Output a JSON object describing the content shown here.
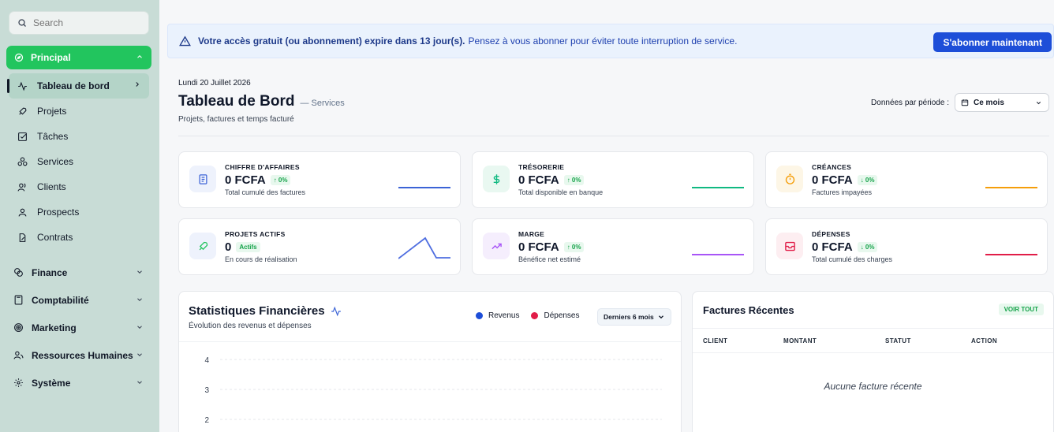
{
  "sidebar": {
    "search_placeholder": "Search",
    "principal_label": "Principal",
    "items": [
      {
        "label": "Tableau de bord",
        "icon": "activity-icon"
      },
      {
        "label": "Projets",
        "icon": "rocket-icon"
      },
      {
        "label": "Tâches",
        "icon": "checkbox-icon"
      },
      {
        "label": "Services",
        "icon": "boxes-icon"
      },
      {
        "label": "Clients",
        "icon": "users-icon"
      },
      {
        "label": "Prospects",
        "icon": "user-icon"
      },
      {
        "label": "Contrats",
        "icon": "file-edit-icon"
      }
    ],
    "groups": [
      {
        "label": "Finance",
        "icon": "coins-icon"
      },
      {
        "label": "Comptabilité",
        "icon": "calculator-icon"
      },
      {
        "label": "Marketing",
        "icon": "target-icon"
      },
      {
        "label": "Ressources Humaines",
        "icon": "people-icon"
      },
      {
        "label": "Système",
        "icon": "gear-icon"
      }
    ]
  },
  "banner": {
    "strong": "Votre accès gratuit (ou abonnement) expire dans 13 jour(s).",
    "rest": "Pensez à vous abonner pour éviter toute interruption de service.",
    "button": "S'abonner maintenant"
  },
  "header": {
    "date": "Lundi 20 Juillet 2026",
    "title": "Tableau de Bord",
    "title_sub": "— Services",
    "subtitle": "Projets, factures et temps facturé",
    "period_label": "Données par période :",
    "period_value": "Ce mois"
  },
  "cards": [
    {
      "title": "CHIFFRE D'AFFAIRES",
      "value": "0 FCFA",
      "badge": "↑ 0%",
      "desc": "Total cumulé des factures",
      "icon": "document-icon",
      "color": "#3b63d6"
    },
    {
      "title": "TRÉSORERIE",
      "value": "0 FCFA",
      "badge": "↑ 0%",
      "desc": "Total disponible en banque",
      "icon": "dollar-icon",
      "color": "#10b981"
    },
    {
      "title": "CRÉANCES",
      "value": "0 FCFA",
      "badge": "↓ 0%",
      "desc": "Factures impayées",
      "icon": "timer-icon",
      "color": "#f59e0b"
    },
    {
      "title": "PROJETS ACTIFS",
      "value": "0",
      "badge": "Actifs",
      "desc": "En cours de réalisation",
      "icon": "rocket-icon",
      "color": "#22c55e"
    },
    {
      "title": "MARGE",
      "value": "0 FCFA",
      "badge": "↑ 0%",
      "desc": "Bénéfice net estimé",
      "icon": "trend-up-icon",
      "color": "#a855f7"
    },
    {
      "title": "DÉPENSES",
      "value": "0 FCFA",
      "badge": "↓ 0%",
      "desc": "Total cumulé des charges",
      "icon": "inbox-icon",
      "color": "#e11d48"
    }
  ],
  "stats": {
    "title": "Statistiques Financières",
    "subtitle": "Évolution des revenus et dépenses",
    "legend_revenus": "Revenus",
    "legend_depenses": "Dépenses",
    "range": "Derniers 6 mois",
    "revenus_color": "#1d4ed8",
    "depenses_color": "#e11d48"
  },
  "chart_data": {
    "type": "line",
    "title": "Statistiques Financières",
    "series": [
      {
        "name": "Revenus",
        "values": []
      },
      {
        "name": "Dépenses",
        "values": []
      }
    ],
    "yticks": [
      "4",
      "3",
      "2"
    ],
    "ylim": [
      0,
      4
    ],
    "grid": true
  },
  "invoices": {
    "title": "Factures Récentes",
    "voir_tout": "VOIR TOUT",
    "columns": [
      "CLIENT",
      "MONTANT",
      "STATUT",
      "ACTION"
    ],
    "empty": "Aucune facture récente"
  }
}
